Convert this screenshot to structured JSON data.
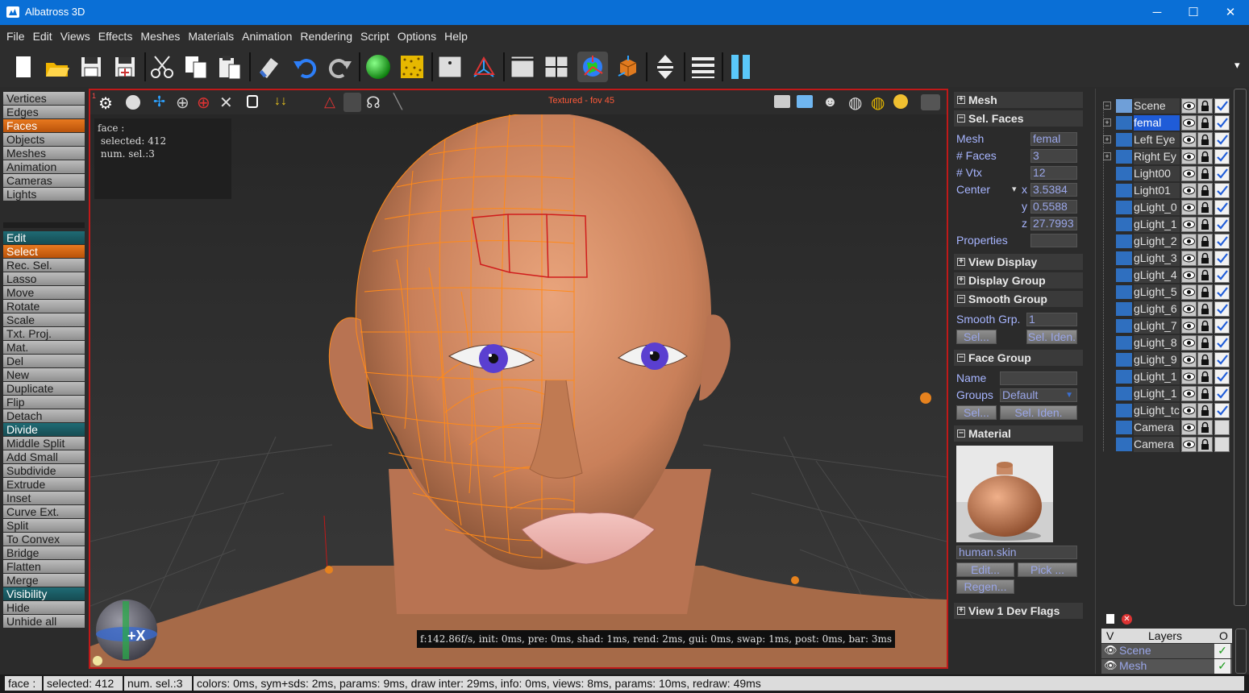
{
  "window": {
    "title": "Albatross 3D",
    "minimize": "─",
    "maximize": "☐",
    "close": "✕"
  },
  "menu": [
    "File",
    "Edit",
    "Views",
    "Effects",
    "Meshes",
    "Materials",
    "Animation",
    "Rendering",
    "Script",
    "Options",
    "Help"
  ],
  "toolbar": {
    "overflow": "▾",
    "icons": [
      "new-file-icon",
      "open-folder-icon",
      "save-icon",
      "save-as-icon",
      "cut-icon",
      "copy-icon",
      "paste-icon",
      "eraser-icon",
      "undo-icon",
      "redo-icon",
      "sphere-icon",
      "texture-icon",
      "view-single-icon",
      "axis-icon",
      "split-vertical-icon",
      "split-quad-icon",
      "globe-world-icon",
      "box-3d-icon",
      "move-vertical-icon",
      "list-icon",
      "pause-icon"
    ]
  },
  "left_panel": {
    "modes": [
      "Vertices",
      "Edges",
      "Faces",
      "Objects",
      "Meshes",
      "Animation",
      "Cameras",
      "Lights"
    ],
    "active_mode": "Faces",
    "tools": [
      {
        "label": "Edit",
        "type": "header"
      },
      {
        "label": "Select",
        "type": "selected"
      },
      {
        "label": "Rec. Sel."
      },
      {
        "label": "Lasso"
      },
      {
        "label": "Move"
      },
      {
        "label": "Rotate"
      },
      {
        "label": "Scale"
      },
      {
        "label": "Txt. Proj."
      },
      {
        "label": "Mat."
      },
      {
        "label": "Del"
      },
      {
        "label": "New"
      },
      {
        "label": "Duplicate"
      },
      {
        "label": "Flip"
      },
      {
        "label": "Detach"
      },
      {
        "label": "Divide",
        "type": "header"
      },
      {
        "label": "Middle Split"
      },
      {
        "label": "Add Small"
      },
      {
        "label": "Subdivide"
      },
      {
        "label": "Extrude"
      },
      {
        "label": "Inset"
      },
      {
        "label": "Curve Ext."
      },
      {
        "label": "Split"
      },
      {
        "label": "To Convex"
      },
      {
        "label": "Bridge"
      },
      {
        "label": "Flatten"
      },
      {
        "label": "Merge"
      },
      {
        "label": "Visibility",
        "type": "header"
      },
      {
        "label": "Hide"
      },
      {
        "label": "Unhide all"
      }
    ]
  },
  "viewport": {
    "index": "1",
    "label": "Textured - fov 45",
    "info": [
      "face :",
      " selected: 412",
      " num. sel.:3"
    ],
    "stats": "f:142.86f/s, init: 0ms, pre: 0ms, shad: 1ms, rend: 2ms, gui: 0ms, swap: 1ms, post: 0ms, bar: 3ms",
    "gizmo_label": "+X"
  },
  "properties": {
    "mesh_section": "Mesh",
    "sel_faces_section": "Sel. Faces",
    "mesh_label": "Mesh",
    "mesh_value": "femal",
    "faces_label": "# Faces",
    "faces_value": "3",
    "vtx_label": "# Vtx",
    "vtx_value": "12",
    "center_label": "Center",
    "center_arrow": "▾",
    "x_label": "x",
    "x_value": "3.5384",
    "y_label": "y",
    "y_value": "0.5588",
    "z_label": "z",
    "z_value": "27.7993",
    "properties_label": "Properties",
    "view_display": "View Display",
    "display_group": "Display Group",
    "smooth_group": "Smooth Group",
    "smooth_grp_label": "Smooth Grp.",
    "smooth_grp_value": "1",
    "sel_button": "Sel...",
    "sel_iden_button": "Sel. Iden.",
    "face_group": "Face Group",
    "name_label": "Name",
    "groups_label": "Groups",
    "groups_value": "Default",
    "fg_sel_button": "Sel...",
    "fg_sel_iden_button": "Sel. Iden.",
    "material_section": "Material",
    "material_name": "human.skin",
    "edit_button": "Edit...",
    "pick_button": "Pick ...",
    "regen_button": "Regen...",
    "view1_dev_flags": "View 1 Dev Flags"
  },
  "scene_tree": [
    {
      "name": "Scene",
      "expander": "−",
      "type": "folder",
      "check": true
    },
    {
      "name": "femal",
      "expander": "+",
      "type": "mesh",
      "selected": true,
      "check": true
    },
    {
      "name": "Left Eye",
      "expander": "+",
      "type": "mesh",
      "check": true
    },
    {
      "name": "Right Ey",
      "expander": "+",
      "type": "mesh",
      "check": true
    },
    {
      "name": "Light00",
      "type": "light",
      "check": true
    },
    {
      "name": "Light01",
      "type": "light",
      "check": true
    },
    {
      "name": "gLight_0",
      "type": "light",
      "check": true
    },
    {
      "name": "gLight_1",
      "type": "light",
      "check": true
    },
    {
      "name": "gLight_2",
      "type": "light",
      "check": true
    },
    {
      "name": "gLight_3",
      "type": "light",
      "check": true
    },
    {
      "name": "gLight_4",
      "type": "light",
      "check": true
    },
    {
      "name": "gLight_5",
      "type": "light",
      "check": true
    },
    {
      "name": "gLight_6",
      "type": "light",
      "check": true
    },
    {
      "name": "gLight_7",
      "type": "light",
      "check": true
    },
    {
      "name": "gLight_8",
      "type": "light",
      "check": true
    },
    {
      "name": "gLight_9",
      "type": "light",
      "check": true
    },
    {
      "name": "gLight_1",
      "type": "light",
      "check": true
    },
    {
      "name": "gLight_1",
      "type": "light",
      "check": true
    },
    {
      "name": "gLight_tc",
      "type": "light",
      "check": true
    },
    {
      "name": "Camera",
      "type": "camera",
      "check": false
    },
    {
      "name": "Camera",
      "type": "camera",
      "check": false
    }
  ],
  "layers": {
    "header_v": "V",
    "header_name": "Layers",
    "header_o": "O",
    "rows": [
      {
        "name": "Scene"
      },
      {
        "name": "Mesh"
      }
    ]
  },
  "status": [
    "face :",
    "selected: 412",
    "num. sel.:3",
    "colors: 0ms, sym+sds: 2ms, params: 9ms, draw inter: 29ms, info: 0ms, views: 8ms, params: 10ms, redraw: 49ms"
  ],
  "colors": {
    "accent_orange": "#e8791f",
    "selection_blue": "#1f5cd8",
    "viewport_border": "#c01919",
    "wire_orange": "#ff8a1a"
  }
}
